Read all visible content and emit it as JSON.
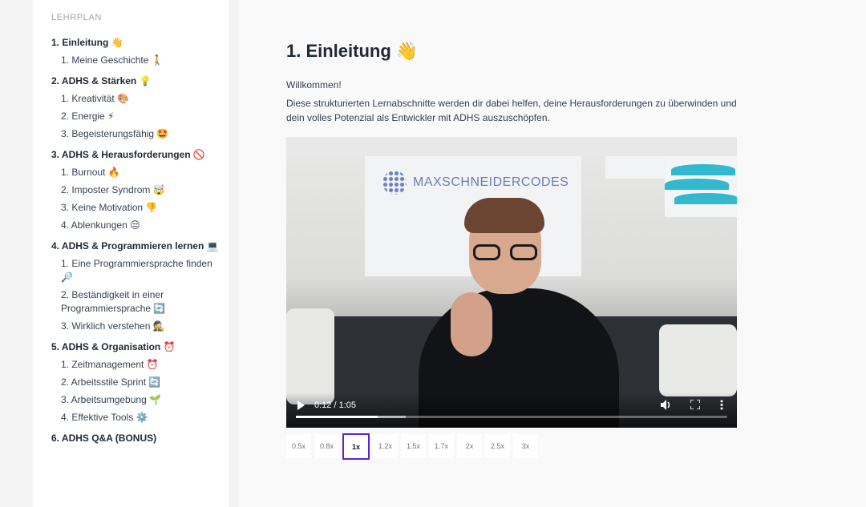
{
  "sidebar": {
    "title": "LEHRPLAN",
    "sections": [
      {
        "title": "1. Einleitung 👋",
        "lessons": [
          "1. Meine Geschichte 🚶"
        ]
      },
      {
        "title": "2. ADHS & Stärken 💡",
        "lessons": [
          "1. Kreativität 🎨",
          "2. Energie ⚡",
          "3. Begeisterungsfähig 🤩"
        ]
      },
      {
        "title": "3. ADHS & Herausforderungen 🚫",
        "lessons": [
          "1. Burnout 🔥",
          "2. Imposter Syndrom 🤯",
          "3. Keine Motivation 👎",
          "4. Ablenkungen 😒"
        ]
      },
      {
        "title": "4. ADHS & Programmieren lernen 💻",
        "lessons": [
          "1. Eine Programmiersprache finden 🔎",
          "2. Beständigkeit in einer Programmiersprache 🔄",
          "3. Wirklich verstehen 🕵"
        ]
      },
      {
        "title": "5. ADHS & Organisation ⏰",
        "lessons": [
          "1. Zeitmanagement ⏰",
          "2. Arbeitsstile Sprint 🔄",
          "3. Arbeitsumgebung 🌱",
          "4. Effektive Tools ⚙️"
        ]
      },
      {
        "title": "6. ADHS Q&A (BONUS)",
        "lessons": []
      }
    ]
  },
  "main": {
    "title": "1. Einleitung 👋",
    "welcome": "Willkommen!",
    "intro": "Diese strukturierten Lernabschnitte werden dir dabei helfen, deine Herausforderungen zu überwinden und dein volles Potenzial als Entwickler mit ADHS auszuschöpfen."
  },
  "video": {
    "brand_text": "MAXSCHNEIDERCODES",
    "time": "0:12 / 1:05",
    "progress_fraction": 0.19,
    "buffered_fraction": 0.254,
    "icons": {
      "play": "play-icon",
      "volume": "volume-icon",
      "fullscreen": "fullscreen-icon",
      "more": "more-vertical-icon"
    }
  },
  "speeds": {
    "options": [
      "0.5x",
      "0.8x",
      "1x",
      "1.2x",
      "1.5x",
      "1.7x",
      "2x",
      "2.5x",
      "3x"
    ],
    "selected": "1x"
  },
  "colors": {
    "accent": "#5b21d6",
    "background": "#f9f9f9",
    "sidebar": "#ffffff"
  }
}
